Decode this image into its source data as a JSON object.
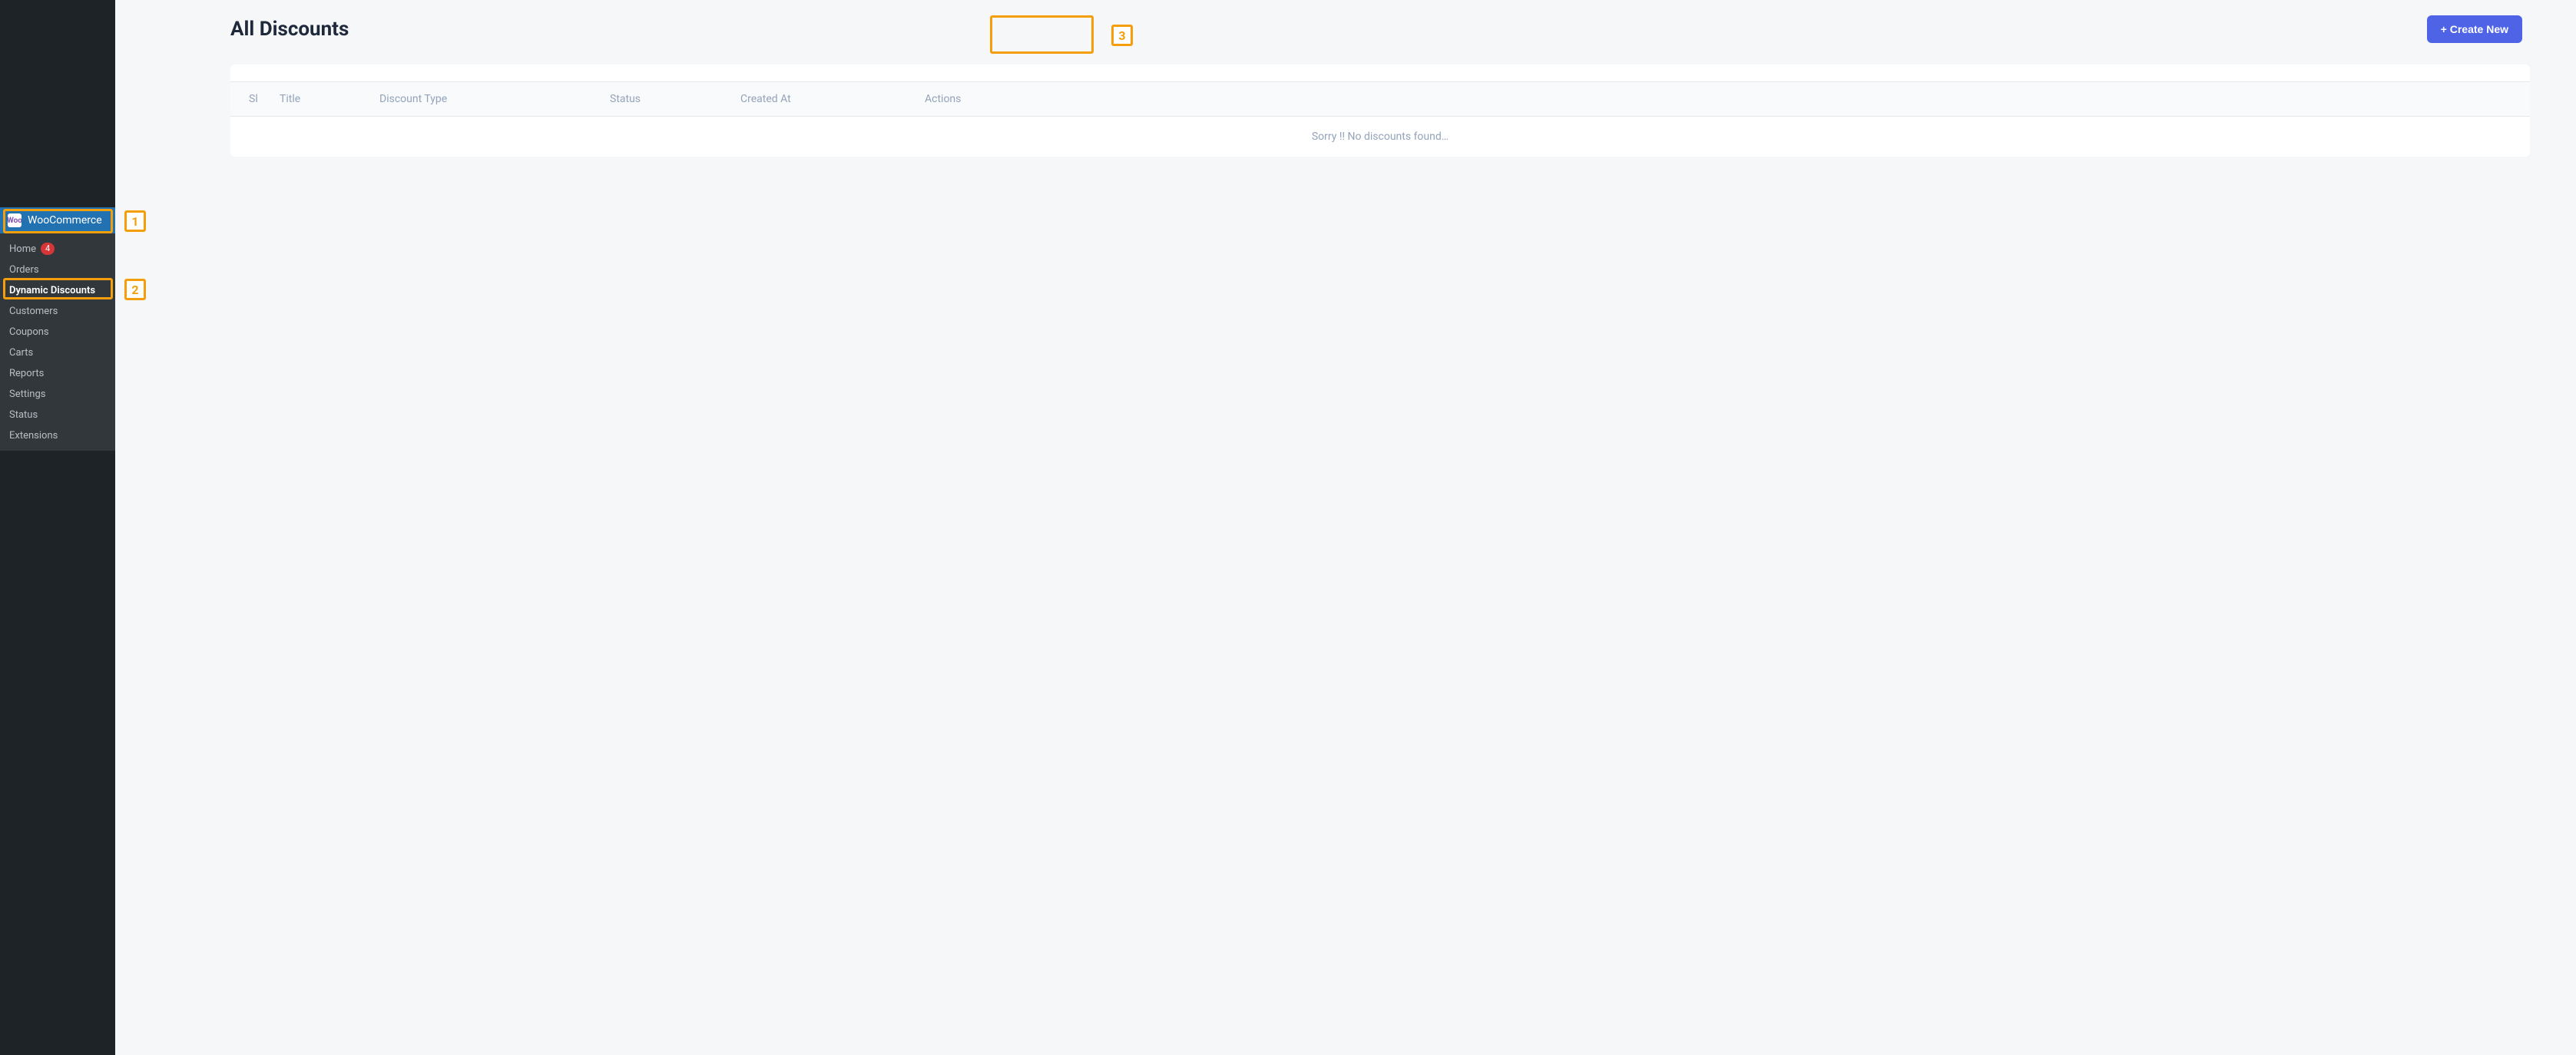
{
  "page": {
    "title": "All Discounts",
    "create_button": "+ Create New"
  },
  "sidebar": {
    "woo_label": "WooCommerce",
    "woo_icon_text": "Woo",
    "items": [
      {
        "label": "Home",
        "badge": "4",
        "active": false
      },
      {
        "label": "Orders",
        "badge": null,
        "active": false
      },
      {
        "label": "Dynamic Discounts",
        "badge": null,
        "active": true
      },
      {
        "label": "Customers",
        "badge": null,
        "active": false
      },
      {
        "label": "Coupons",
        "badge": null,
        "active": false
      },
      {
        "label": "Carts",
        "badge": null,
        "active": false
      },
      {
        "label": "Reports",
        "badge": null,
        "active": false
      },
      {
        "label": "Settings",
        "badge": null,
        "active": false
      },
      {
        "label": "Status",
        "badge": null,
        "active": false
      },
      {
        "label": "Extensions",
        "badge": null,
        "active": false
      }
    ]
  },
  "table": {
    "columns": {
      "sl": "Sl",
      "title": "Title",
      "type": "Discount Type",
      "status": "Status",
      "created": "Created At",
      "actions": "Actions"
    },
    "empty_message": "Sorry !! No discounts found…"
  },
  "annotations": {
    "marker1": "1",
    "marker2": "2",
    "marker3": "3"
  }
}
